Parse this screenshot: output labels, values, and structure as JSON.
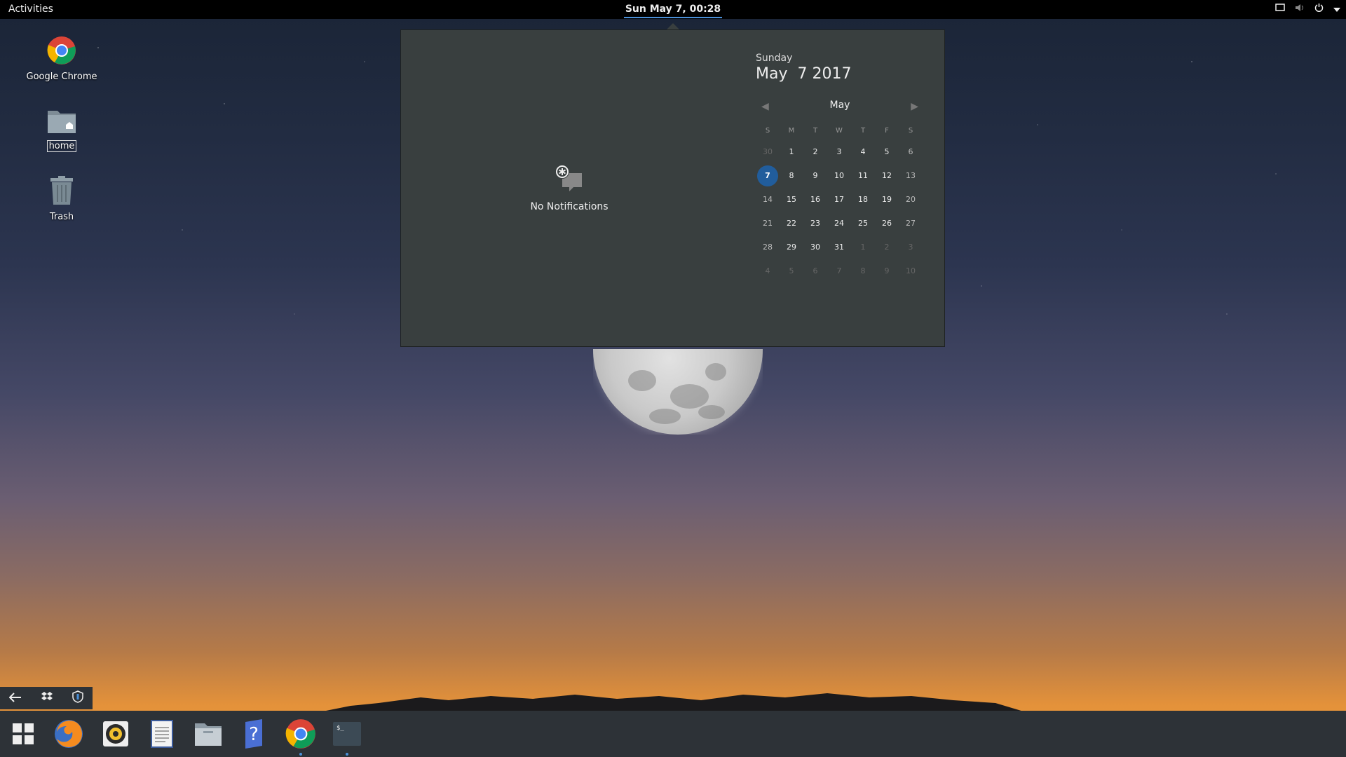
{
  "topbar": {
    "activities": "Activities",
    "clock": "Sun May  7, 00:28"
  },
  "desktop": {
    "icons": [
      {
        "label": "Google Chrome"
      },
      {
        "label": "home"
      },
      {
        "label": "Trash"
      }
    ]
  },
  "notifications": {
    "empty_text": "No Notifications"
  },
  "calendar": {
    "day_of_week": "Sunday",
    "full_date": "May  7 2017",
    "month": "May",
    "weekday_headers": [
      "S",
      "M",
      "T",
      "W",
      "T",
      "F",
      "S"
    ],
    "weeks": [
      [
        "30",
        "1",
        "2",
        "3",
        "4",
        "5",
        "6"
      ],
      [
        "7",
        "8",
        "9",
        "10",
        "11",
        "12",
        "13"
      ],
      [
        "14",
        "15",
        "16",
        "17",
        "18",
        "19",
        "20"
      ],
      [
        "21",
        "22",
        "23",
        "24",
        "25",
        "26",
        "27"
      ],
      [
        "28",
        "29",
        "30",
        "31",
        "1",
        "2",
        "3"
      ],
      [
        "4",
        "5",
        "6",
        "7",
        "8",
        "9",
        "10"
      ]
    ],
    "today": "7",
    "accent_color": "#215d9c"
  },
  "dock": {
    "apps": [
      "app-grid",
      "firefox",
      "rhythmbox",
      "text-editor",
      "files",
      "help",
      "google-chrome",
      "terminal"
    ]
  }
}
